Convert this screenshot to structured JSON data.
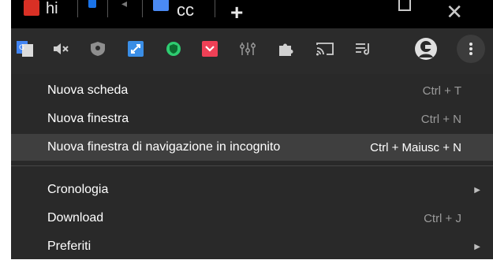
{
  "titlebar": {
    "tab_text": "hi",
    "cc_text": "cc",
    "plus": "+",
    "close": "✕"
  },
  "toolbar": {
    "icons": [
      "google-translate-icon",
      "mute-tab-icon",
      "shield-icon",
      "fullscreen-icon",
      "adguard-icon",
      "pocket-icon",
      "equalizer-icon",
      "extensions-icon",
      "cast-icon",
      "reading-list-icon",
      "profile-avatar-icon",
      "more-menu-icon"
    ]
  },
  "menu": {
    "items": [
      {
        "label": "Nuova scheda",
        "shortcut": "Ctrl + T"
      },
      {
        "label": "Nuova finestra",
        "shortcut": "Ctrl + N"
      },
      {
        "label": "Nuova finestra di navigazione in incognito",
        "shortcut": "Ctrl + Maiusc + N"
      },
      {
        "label": "Cronologia",
        "shortcut": ""
      },
      {
        "label": "Download",
        "shortcut": "Ctrl + J"
      },
      {
        "label": "Preferiti",
        "shortcut": ""
      }
    ]
  },
  "colors": {
    "menu_bg": "#292929",
    "highlight": "#3f3f3f",
    "titlebar": "#000000"
  }
}
